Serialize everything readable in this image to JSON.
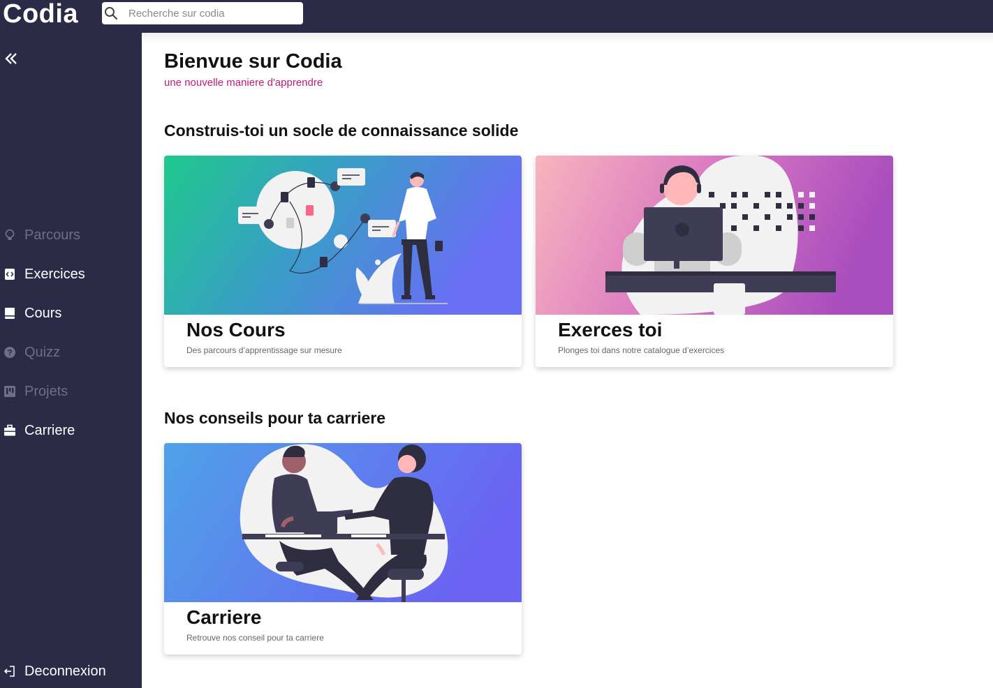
{
  "app": {
    "logo": "Codia"
  },
  "search": {
    "placeholder": "Recherche sur codia"
  },
  "sidebar": {
    "items": [
      {
        "label": "Parcours",
        "icon": "lightbulb-icon"
      },
      {
        "label": "Exercices",
        "icon": "code-file-icon"
      },
      {
        "label": "Cours",
        "icon": "book-icon"
      },
      {
        "label": "Quizz",
        "icon": "help-circle-icon"
      },
      {
        "label": "Projets",
        "icon": "kanban-icon"
      },
      {
        "label": "Carriere",
        "icon": "briefcase-icon"
      }
    ],
    "logout": {
      "label": "Deconnexion",
      "icon": "logout-icon"
    }
  },
  "main": {
    "title": "Bienvue sur Codia",
    "subtitle": "une nouvelle maniere d'apprendre",
    "sections": [
      {
        "title": "Construis-toi un socle de connaissance solide",
        "cards": [
          {
            "title": "Nos Cours",
            "description": "Des parcours d’apprentissage sur mesure"
          },
          {
            "title": "Exerces toi",
            "description": "Plonges toi dans notre catalogue d’exercices"
          }
        ]
      },
      {
        "title": "Nos conseils pour ta carriere",
        "cards": [
          {
            "title": "Carriere",
            "description": "Retrouve nos conseil pour ta carriere"
          }
        ]
      }
    ]
  },
  "colors": {
    "sidebar_bg": "#2b2a47",
    "accent": "#c2187b",
    "dim_text": "#6f6e86"
  }
}
